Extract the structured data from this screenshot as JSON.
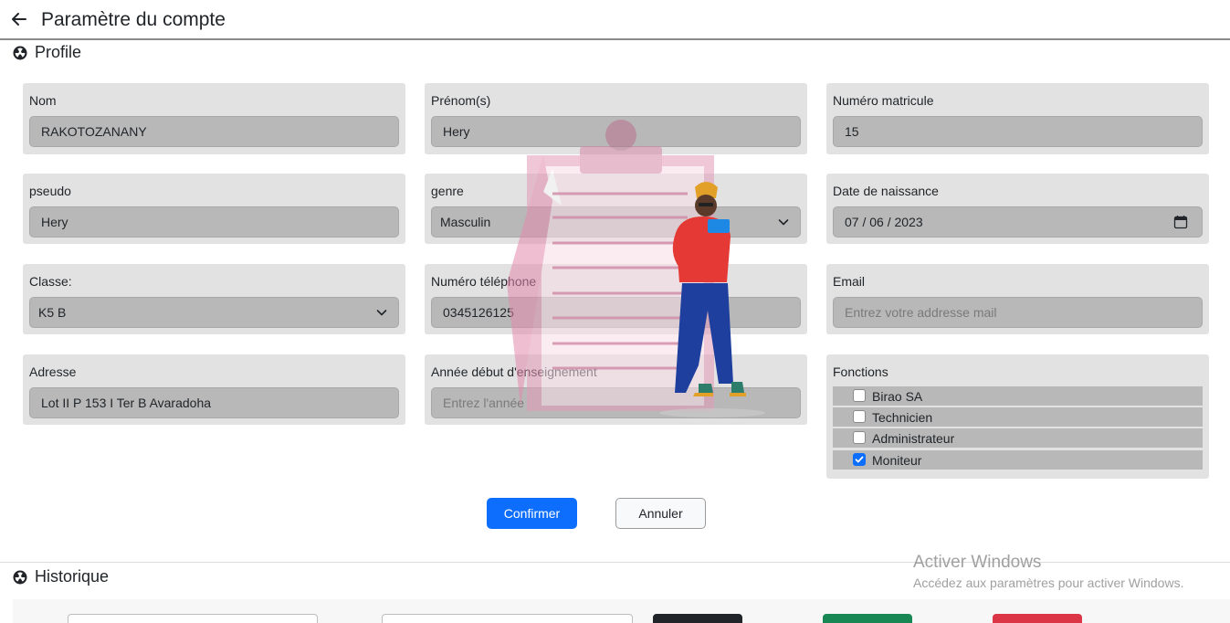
{
  "header": {
    "title": "Paramètre du compte",
    "back_icon": "arrow-left-icon"
  },
  "profile": {
    "section_title": "Profile",
    "section_icon": "radiation-icon",
    "fields": {
      "nom": {
        "label": "Nom",
        "value": "RAKOTOZANANY"
      },
      "prenoms": {
        "label": "Prénom(s)",
        "value": "Hery"
      },
      "matricule": {
        "label": "Numéro matricule",
        "value": "15"
      },
      "pseudo": {
        "label": "pseudo",
        "value": "Hery"
      },
      "genre": {
        "label": "genre",
        "value": "Masculin"
      },
      "naissance": {
        "label": "Date de naissance",
        "value": "07 / 06 / 2023"
      },
      "classe": {
        "label": "Classe:",
        "value": "K5 B"
      },
      "telephone": {
        "label": "Numéro téléphone",
        "value": "0345126125"
      },
      "email": {
        "label": "Email",
        "placeholder": "Entrez votre addresse mail"
      },
      "adresse": {
        "label": "Adresse",
        "value": "Lot II P 153 I Ter B Avaradoha"
      },
      "annee": {
        "label": "Année début d'enseignement",
        "placeholder": "Entrez l'année"
      }
    },
    "fonctions": {
      "label": "Fonctions",
      "items": [
        {
          "label": "Birao SA",
          "checked": false
        },
        {
          "label": "Technicien",
          "checked": false
        },
        {
          "label": "Administrateur",
          "checked": false
        },
        {
          "label": "Moniteur",
          "checked": true
        }
      ]
    },
    "actions": {
      "confirm": "Confirmer",
      "cancel": "Annuler"
    }
  },
  "history": {
    "section_title": "Historique",
    "section_icon": "radiation-icon"
  },
  "colors": {
    "primary": "#0d6efd",
    "card_bg": "#e2e2e2",
    "field_bg": "#b8b8b8"
  },
  "watermark": {
    "title": "Activer Windows",
    "subtitle": "Accédez aux paramètres pour activer Windows."
  }
}
